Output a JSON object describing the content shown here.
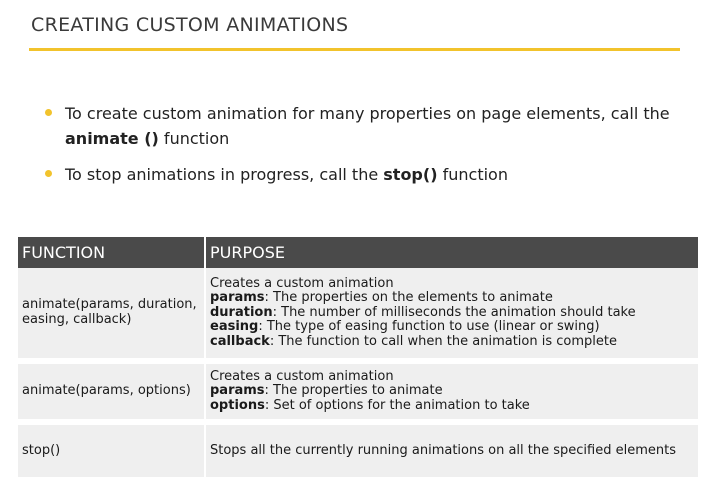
{
  "title": "CREATING CUSTOM ANIMATIONS",
  "bullets": [
    {
      "part1": "To create custom animation for many properties on page elements, call the ",
      "bold": "animate ()",
      "part2": " function"
    },
    {
      "part1": "To stop animations in progress, call the ",
      "bold": "stop()",
      "part2": " function"
    }
  ],
  "table": {
    "headers": [
      "FUNCTION",
      "PURPOSE"
    ],
    "rows": [
      {
        "function_lines": [
          "animate(params, duration,",
          "easing, callback)"
        ],
        "purpose_intro": "Creates a custom animation",
        "params": [
          {
            "name": "params",
            "desc": ": The properties on the elements to animate"
          },
          {
            "name": "duration",
            "desc": ": The number of milliseconds the animation should take"
          },
          {
            "name": "easing",
            "desc": ": The type of easing function to use (linear or swing)"
          },
          {
            "name": "callback",
            "desc": ": The function to call when the animation is complete"
          }
        ]
      },
      {
        "function_lines": [
          "animate(params, options)"
        ],
        "purpose_intro": "Creates a custom animation",
        "params": [
          {
            "name": "params",
            "desc": ": The properties to animate"
          },
          {
            "name": "options",
            "desc": ": Set of options for the animation to take"
          }
        ]
      },
      {
        "function_lines": [
          "stop()"
        ],
        "purpose_intro": "Stops all the currently running animations on all the specified elements",
        "params": []
      }
    ]
  },
  "colors": {
    "accent": "#f2c32c",
    "header_bg": "#4a4a4a",
    "row_bg": "#efefef"
  }
}
